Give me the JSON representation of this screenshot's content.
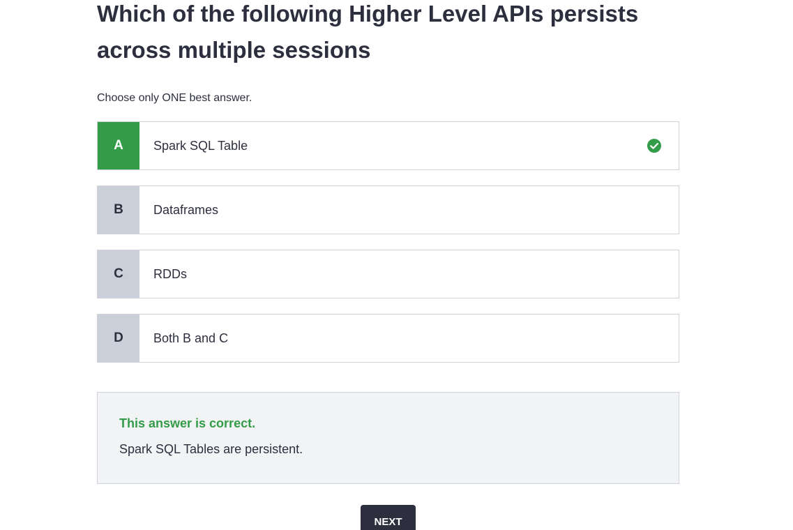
{
  "question": {
    "title": "Which of the following Higher Level APIs persists across multiple sessions",
    "instruction": "Choose only ONE best answer."
  },
  "options": [
    {
      "letter": "A",
      "text": "Spark SQL Table",
      "selected": true,
      "status_icon": "check-circle-icon"
    },
    {
      "letter": "B",
      "text": "Dataframes",
      "selected": false
    },
    {
      "letter": "C",
      "text": "RDDs",
      "selected": false
    },
    {
      "letter": "D",
      "text": "Both B and C",
      "selected": false
    }
  ],
  "feedback": {
    "status": "This answer is correct.",
    "explanation": "Spark SQL Tables are persistent."
  },
  "actions": {
    "next_label": "NEXT"
  },
  "colors": {
    "correct": "#339c48",
    "text": "#2d2f3e",
    "letter_bg": "#cbcfd9",
    "feedback_bg": "#f2f3f5"
  }
}
